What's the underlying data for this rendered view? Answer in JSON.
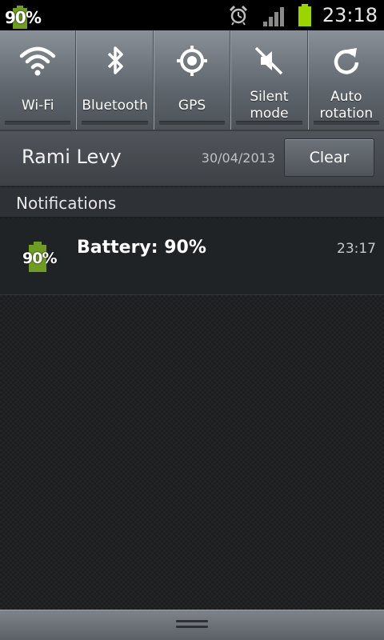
{
  "status_bar": {
    "battery_percent_text": "90%",
    "time": "23:18",
    "icons": [
      "battery-icon",
      "alarm-icon",
      "signal-icon",
      "battery-level-icon"
    ]
  },
  "quick_settings": {
    "tiles": [
      {
        "label": "Wi-Fi",
        "icon": "wifi-icon"
      },
      {
        "label": "Bluetooth",
        "icon": "bluetooth-icon"
      },
      {
        "label": "GPS",
        "icon": "gps-icon"
      },
      {
        "label": "Silent mode",
        "label_line1": "Silent",
        "label_line2": "mode",
        "icon": "silent-mode-icon"
      },
      {
        "label": "Auto rotation",
        "label_line1": "Auto",
        "label_line2": "rotation",
        "icon": "auto-rotation-icon"
      }
    ]
  },
  "operator": {
    "name": "Rami Levy",
    "date": "30/04/2013",
    "clear_label": "Clear"
  },
  "notifications": {
    "header": "Notifications",
    "items": [
      {
        "title": "Battery: 90%",
        "time": "23:17",
        "icon_text": "90%",
        "icon": "battery-icon"
      }
    ]
  },
  "colors": {
    "battery_green": "#6f9d23",
    "status_battery": "#9bd400"
  }
}
